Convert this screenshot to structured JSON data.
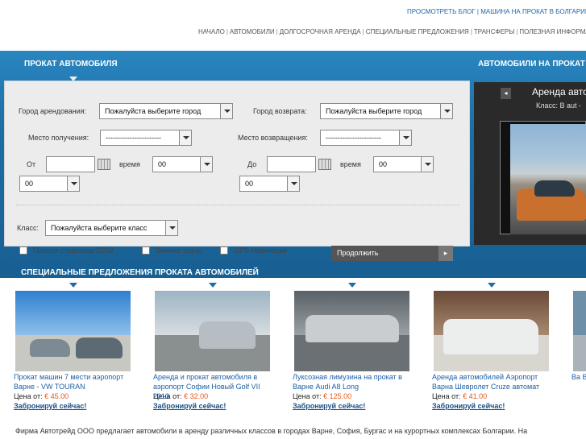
{
  "top_links": {
    "blog": "ПРОСМОТРЕТЬ БЛОГ",
    "sep": "|",
    "car_bulgaria": "МАШИНА НА ПРОКАТ В БОЛГАРИИ"
  },
  "nav": [
    "НАЧАЛО",
    "АВТОМОБИЛИ",
    "ДОЛГОСРОЧНАЯ АРЕНДА",
    "СПЕЦИАЛЬНЫЕ ПРЕДЛОЖЕНИЯ",
    "ТРАНСФЕРЫ",
    "ПОЛЕЗНАЯ ИНФОРМАЦИЯ"
  ],
  "nav_sep": "|",
  "rental_title": "ПРОКАТ АВТОМОБИЛЯ",
  "cars_title": "АВТОМОБИЛИ НА ПРОКАТ",
  "form": {
    "pickup_city_label": "Город арендования:",
    "pickup_city_value": "Пожалуйста выберите город",
    "return_city_label": "Город возврата:",
    "return_city_value": "Пожалуйста выберите город",
    "pickup_place_label": "Место получения:",
    "pickup_place_value": "-----------------------",
    "return_place_label": "Место возвращения:",
    "return_place_value": "-----------------------",
    "from_label": "От",
    "to_label": "До",
    "time_label": "время",
    "hour_value": "00",
    "minute_value": "00",
    "class_label": "Класс:",
    "class_value": "Пожалуйста выберите класс",
    "opt_cdw": "Полная страховка CDW",
    "opt_winter": "Зимние шины",
    "opt_gps": "GPS Навигация",
    "continue_label": "Продолжить",
    "continue_arrow": "▸"
  },
  "slider": {
    "prev": "◂",
    "title": "Аренда авто",
    "class_text": "Класс: B aut -"
  },
  "special_title": "СПЕЦИАЛЬНЫЕ ПРЕДЛОЖЕНИЯ ПРОКАТА АВТОМОБИЛЕЙ",
  "price_label": "Цена от:",
  "book_label": "Забронируй сейчас!",
  "offers": [
    {
      "title": "Прокат машин 7 мести аэропорт Варне - VW TOURAN",
      "price": "€ 45.00"
    },
    {
      "title": "Аренда и прокат автомобиля в аэропорт Софии Новый Golf VII 2013",
      "price": "€ 32.00"
    },
    {
      "title": "Луксозная лимузина на прокат в Варне Audi A8 Long",
      "price": "€ 125.00"
    },
    {
      "title": "Аренда автомобилей Аэропорт Варна Шевролет Cruze автомат",
      "price": "€ 41.00"
    },
    {
      "title": "Ва Ва",
      "price": ""
    }
  ],
  "bottom_text": "Фирма Автотрейд ООО предлагает автомобили в аренду различных классов в городах Варне, София, Бургас и на курортных комплексах Болгарии. На"
}
